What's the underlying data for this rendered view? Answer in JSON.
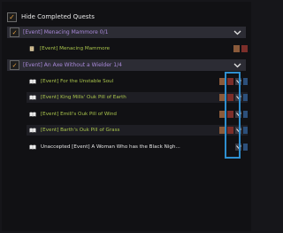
{
  "hide_completed": {
    "label": "Hide Completed Quests",
    "checked": true
  },
  "groups": [
    {
      "title": "[Event] Menacing Mammore 0/1",
      "quests": [
        {
          "title": "[Event] Menacing Mammore",
          "color": "green"
        }
      ]
    },
    {
      "title": "[Event] An Axe Without a Wielder 1/4",
      "quests": [
        {
          "title": "[Event] For the Unstable Soul",
          "color": "green"
        },
        {
          "title": "[Event] King Mills' Ouk Pill of Earth",
          "color": "green"
        },
        {
          "title": "[Event] Emill's Ouk Pill of Wind",
          "color": "green"
        },
        {
          "title": "[Event] Barth's Ouk Pill of Grass",
          "color": "green"
        },
        {
          "title": "Unaccepted  [Event] A Woman Who has the Black Nigh...",
          "color": "white"
        }
      ]
    }
  ],
  "colors": {
    "group_title": "#a889d8",
    "quest_green": "#a9c44c",
    "highlight": "#2e8fd0"
  },
  "icons": {
    "book": "book-icon",
    "chevron": "chevron-down-icon",
    "edit": "edit-icon",
    "delete": "delete-icon",
    "move_down": "move-down-icon",
    "pin": "pin-icon"
  }
}
